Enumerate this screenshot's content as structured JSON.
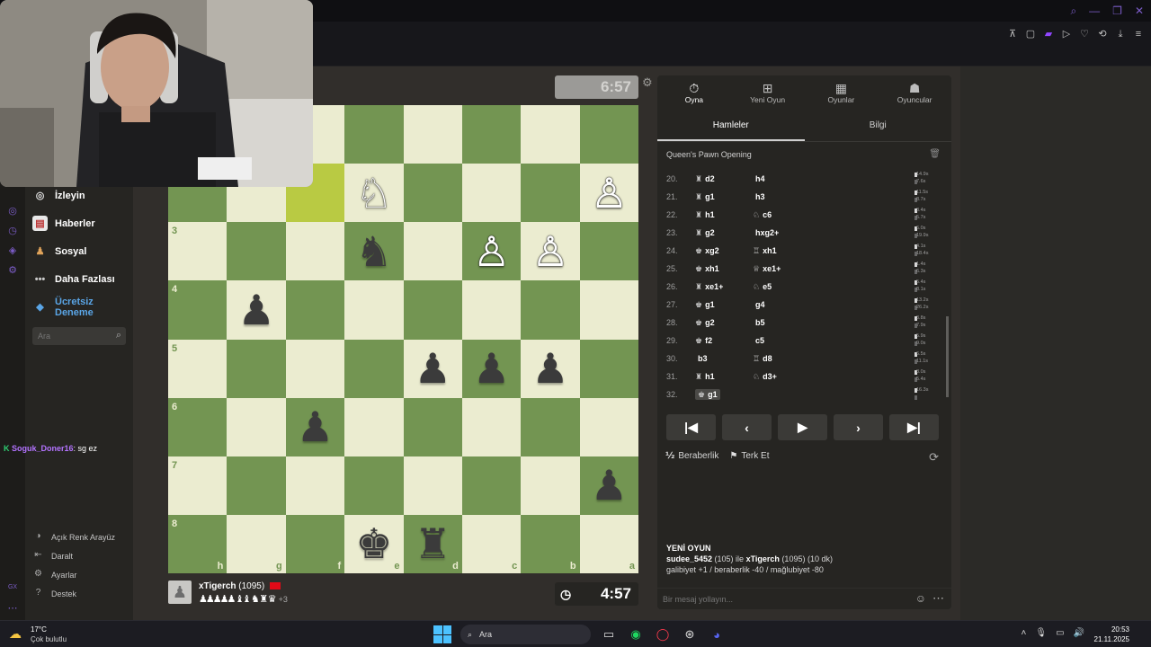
{
  "browser": {
    "window_controls": [
      "⌕",
      "—",
      "❐",
      "✕"
    ],
    "toolbar_icons": [
      "pin-icon",
      "screenshot-icon",
      "twitch-icon",
      "play-icon",
      "heart-icon",
      "share-icon",
      "download-icon",
      "menu-icon"
    ]
  },
  "sidebar": {
    "items": [
      {
        "label": "İzleyin",
        "icon": "binoculars-icon"
      },
      {
        "label": "Haberler",
        "icon": "news-icon"
      },
      {
        "label": "Sosyal",
        "icon": "social-icon"
      },
      {
        "label": "Daha Fazlası",
        "icon": "more-icon"
      },
      {
        "label": "Ücretsiz Deneme",
        "icon": "diamond-icon"
      }
    ],
    "search_placeholder": "Ara",
    "bottom": [
      {
        "label": "Açık Renk Arayüz",
        "icon": "light-theme-icon"
      },
      {
        "label": "Daralt",
        "icon": "collapse-icon"
      },
      {
        "label": "Ayarlar",
        "icon": "settings-icon"
      },
      {
        "label": "Destek",
        "icon": "help-icon"
      }
    ]
  },
  "chat_overlay": {
    "bang": "K",
    "user": "Soguk_Doner16",
    "text": ": sg ez"
  },
  "game": {
    "opponent_clock": "6:57",
    "player_clock": "4:57",
    "player_name": "xTigerch",
    "player_rating": "(1095)",
    "captured": "♟♟♟♟♟ ♝♝ ♞ ♜ ♛",
    "material_advantage": "+3",
    "ranks": [
      "3",
      "4",
      "5",
      "6",
      "7",
      "8"
    ],
    "files": [
      "h",
      "g",
      "f",
      "e",
      "d",
      "c",
      "b",
      "a"
    ],
    "pieces": [
      {
        "square": "e2",
        "piece": "knight",
        "color": "white"
      },
      {
        "square": "a2",
        "piece": "pawn",
        "color": "white"
      },
      {
        "square": "e3",
        "piece": "knight",
        "color": "black"
      },
      {
        "square": "c3",
        "piece": "pawn",
        "color": "white"
      },
      {
        "square": "b3",
        "piece": "pawn",
        "color": "white"
      },
      {
        "square": "g4",
        "piece": "pawn",
        "color": "black"
      },
      {
        "square": "d5",
        "piece": "pawn",
        "color": "black"
      },
      {
        "square": "c5",
        "piece": "pawn",
        "color": "black"
      },
      {
        "square": "b5",
        "piece": "pawn",
        "color": "black"
      },
      {
        "square": "f6",
        "piece": "pawn",
        "color": "black"
      },
      {
        "square": "a7",
        "piece": "pawn",
        "color": "black"
      },
      {
        "square": "e8",
        "piece": "king",
        "color": "black"
      },
      {
        "square": "d8",
        "piece": "rook",
        "color": "black"
      }
    ],
    "highlight": [
      "f2"
    ]
  },
  "panel": {
    "tabs": [
      {
        "label": "Oyna",
        "icon": "stopwatch-icon"
      },
      {
        "label": "Yeni Oyun",
        "icon": "plus-icon"
      },
      {
        "label": "Oyunlar",
        "icon": "board-icon"
      },
      {
        "label": "Oyuncular",
        "icon": "players-icon"
      }
    ],
    "subtabs": [
      "Hamleler",
      "Bilgi"
    ],
    "opening": "Queen's Pawn Opening",
    "moves": [
      {
        "n": "20.",
        "w_sym": "♜",
        "w": "d2",
        "b_sym": "",
        "b": "h4",
        "t1": "14.9s",
        "t2": "7.6s"
      },
      {
        "n": "21.",
        "w_sym": "♜",
        "w": "g1",
        "b_sym": "",
        "b": "h3",
        "t1": "11.5s",
        "t2": "8.7s"
      },
      {
        "n": "22.",
        "w_sym": "♜",
        "w": "h1",
        "b_sym": "♘",
        "b": "c6",
        "t1": "3.4s",
        "t2": "5.7s"
      },
      {
        "n": "23.",
        "w_sym": "♜",
        "w": "g2",
        "b_sym": "",
        "b": "hxg2+",
        "t1": "6.0s",
        "t2": "19.9s"
      },
      {
        "n": "24.",
        "w_sym": "♚",
        "w": "xg2",
        "b_sym": "♖",
        "b": "xh1",
        "t1": "4.1s",
        "t2": "18.4s"
      },
      {
        "n": "25.",
        "w_sym": "♚",
        "w": "xh1",
        "b_sym": "♕",
        "b": "xe1+",
        "t1": "1.4s",
        "t2": "6.3s"
      },
      {
        "n": "26.",
        "w_sym": "♜",
        "w": "xe1+",
        "b_sym": "♘",
        "b": "e5",
        "t1": "5.4s",
        "t2": "8.1s"
      },
      {
        "n": "27.",
        "w_sym": "♚",
        "w": "g1",
        "b_sym": "",
        "b": "g4",
        "t1": "13.2s",
        "t2": "26.2s"
      },
      {
        "n": "28.",
        "w_sym": "♚",
        "w": "g2",
        "b_sym": "",
        "b": "b5",
        "t1": "3.8s",
        "t2": "7.9s"
      },
      {
        "n": "29.",
        "w_sym": "♚",
        "w": "f2",
        "b_sym": "",
        "b": "c5",
        "t1": "5.9s",
        "t2": "9.0s"
      },
      {
        "n": "30.",
        "w_sym": "",
        "w": "b3",
        "b_sym": "♖",
        "b": "d8",
        "t1": "6.5s",
        "t2": "11.1s"
      },
      {
        "n": "31.",
        "w_sym": "♜",
        "w": "h1",
        "b_sym": "♘",
        "b": "d3+",
        "t1": "8.0s",
        "t2": "5.4s"
      },
      {
        "n": "32.",
        "w_sym": "♚",
        "w": "g1",
        "b_sym": "",
        "b": "",
        "t1": "16.3s",
        "t2": ""
      }
    ],
    "nav": [
      "first-move",
      "previous-move",
      "play",
      "next-move",
      "last-move"
    ],
    "draw_label": "Beraberlik",
    "resign_label": "Terk Et",
    "new_game_title": "YENİ OYUN",
    "new_game_line1_a": "sudee_5452",
    "new_game_line1_b": " (105) ile ",
    "new_game_line1_c": "xTigerch",
    "new_game_line1_d": " (1095) (10 dk)",
    "new_game_line2": "galibiyet +1 / beraberlik -40 / mağlubiyet -80",
    "message_placeholder": "Bir mesaj yollayın..."
  },
  "taskbar": {
    "temperature": "17°C",
    "condition": "Çok bulutlu",
    "search": "Ara",
    "time": "20:53",
    "date": "21.11.2025"
  }
}
